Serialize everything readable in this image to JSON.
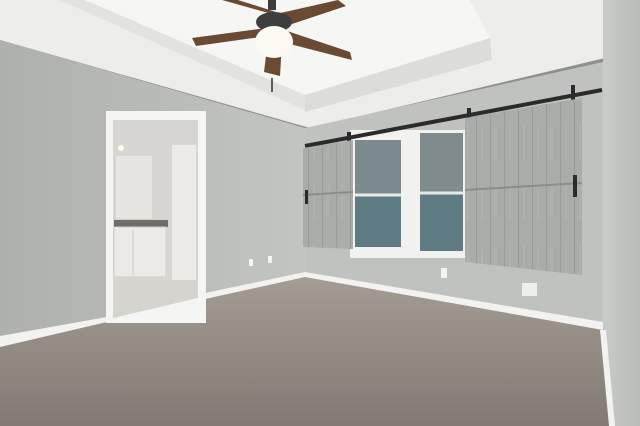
{
  "scene": {
    "description_visible_text": [],
    "colors": {
      "ceiling": "#eeeeec",
      "tray_ceiling": "#f6f6f4",
      "wall_left": "#b4b6b2",
      "wall_back": "#bfc1be",
      "wall_right": "#c8cac7",
      "carpet": "#8b847c",
      "carpet_far": "#a29a91",
      "trim": "#f4f4f2",
      "barn_door": "#a7aba8",
      "barn_door_dark": "#858987",
      "rail": "#2c2c2c",
      "window_glass": "#5f7c84",
      "window_frame": "#f0f0ee",
      "bathroom_wall": "#d9d7d3",
      "bathroom_floor": "#d8d6d0",
      "vanity": "#e9e8e4",
      "fan_blade": "#6b4a33",
      "fan_body": "#3e3e3e",
      "fan_light": "#fbfaf2"
    }
  }
}
